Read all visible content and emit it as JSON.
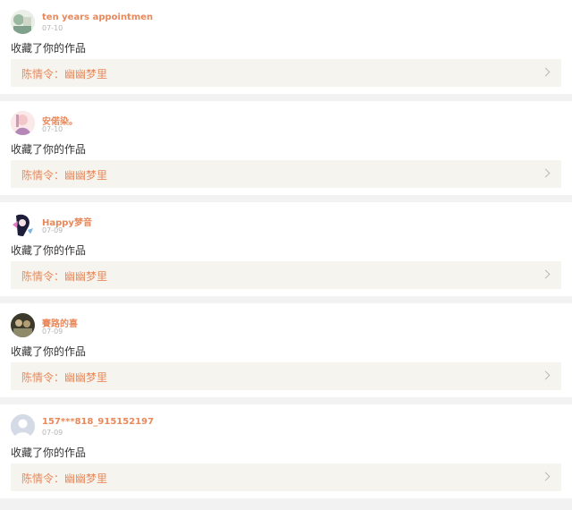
{
  "notifications": [
    {
      "username": "ten years appointmen",
      "date": "07-10",
      "action": "收藏了你的作品",
      "work_title": "陈情令：幽幽梦里",
      "avatar_icon": "avatar-photo-icon",
      "avatar_colors": [
        "#cfd8c8",
        "#7fa08a",
        "#f2f2f2"
      ]
    },
    {
      "username": "安偌染。",
      "date": "07-10",
      "action": "收藏了你的作品",
      "work_title": "陈情令：幽幽梦里",
      "avatar_icon": "avatar-photo-icon",
      "avatar_colors": [
        "#f2c7c9",
        "#b487b8",
        "#fbe8e8"
      ]
    },
    {
      "username": "Happy梦音",
      "date": "07-09",
      "action": "收藏了你的作品",
      "work_title": "陈情令：幽幽梦里",
      "avatar_icon": "avatar-anime-icon",
      "avatar_colors": [
        "#1d1d3a",
        "#e17ac1",
        "#ffffff"
      ]
    },
    {
      "username": "賽路的喜",
      "date": "07-09",
      "action": "收藏了你的作品",
      "work_title": "陈情令：幽幽梦里",
      "avatar_icon": "avatar-photo-icon",
      "avatar_colors": [
        "#3b3a2c",
        "#8f8a6a",
        "#c9b48b"
      ]
    },
    {
      "username": "157***818_915152197",
      "date": "07-09",
      "action": "收藏了你的作品",
      "work_title": "陈情令：幽幽梦里",
      "avatar_icon": "default-avatar-icon",
      "avatar_colors": [
        "#d5dbe6",
        "#ffffff",
        "#ffffff"
      ]
    }
  ],
  "colors": {
    "accent": "#e8895c",
    "date": "#b4b4b4",
    "work_box_bg": "#f5f4ee",
    "page_bg": "#f2f2f2"
  }
}
